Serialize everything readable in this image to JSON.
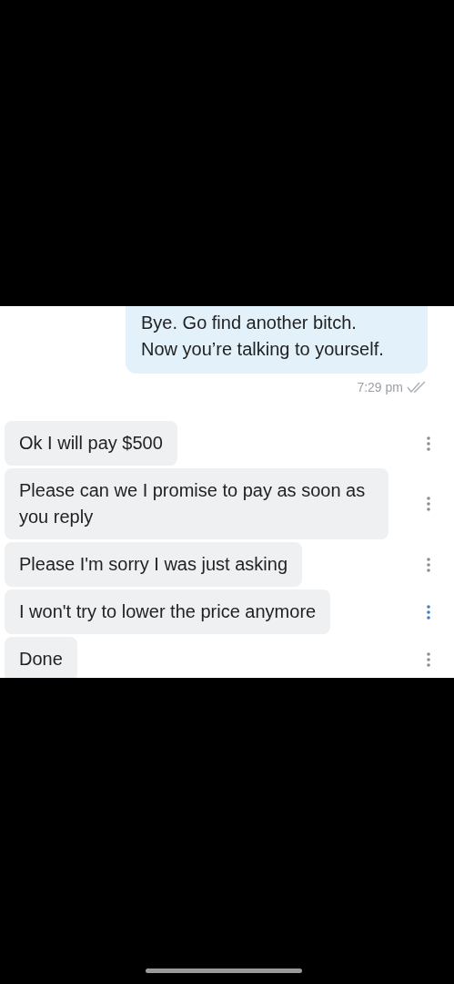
{
  "sent_message": {
    "text": "Bye. Go find another bitch.\nNow you’re talking to yourself.",
    "time": "7:29 pm",
    "read": true
  },
  "received_messages": [
    {
      "text": "Ok I will pay $500",
      "menu_highlighted": false
    },
    {
      "text": "Please can we I promise to pay as soon as you reply",
      "menu_highlighted": false
    },
    {
      "text": "Please I'm sorry I was just asking",
      "menu_highlighted": false
    },
    {
      "text": "I won't try to lower the price anymore",
      "menu_highlighted": true
    },
    {
      "text": "Done",
      "menu_highlighted": false
    }
  ]
}
